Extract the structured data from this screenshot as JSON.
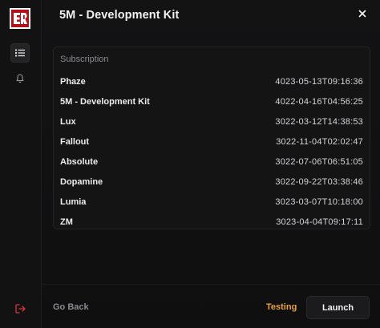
{
  "window": {
    "title": "5M - Development Kit"
  },
  "icons": {
    "logo": "ER",
    "list": "list-icon",
    "bell": "bell-icon",
    "logout": "logout-icon",
    "close": "close-icon"
  },
  "colors": {
    "accent": "#e9a23b",
    "logo_red": "#b0111a",
    "logout_red": "#d9343a"
  },
  "table": {
    "header": "Subscription",
    "rows": [
      {
        "name": "Phaze",
        "date": "4023-05-13T09:16:36"
      },
      {
        "name": "5M - Development Kit",
        "date": "4022-04-16T04:56:25"
      },
      {
        "name": "Lux",
        "date": "3022-03-12T14:38:53"
      },
      {
        "name": "Fallout",
        "date": "3022-11-04T02:02:47"
      },
      {
        "name": "Absolute",
        "date": "3022-07-06T06:51:05"
      },
      {
        "name": "Dopamine",
        "date": "3022-09-22T03:38:46"
      },
      {
        "name": "Lumia",
        "date": "3023-03-07T10:18:00"
      },
      {
        "name": "ZM",
        "date": "3023-04-04T09:17:11"
      }
    ]
  },
  "footer": {
    "go_back": "Go Back",
    "testing": "Testing",
    "launch": "Launch"
  }
}
